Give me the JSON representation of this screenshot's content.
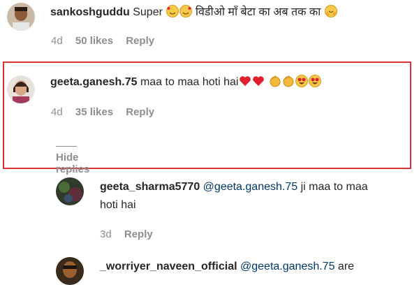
{
  "comments": [
    {
      "username": "sankoshguddu",
      "text_before": "Super",
      "text_after": "विडीओ माँ बेटा का अब तक का",
      "time": "4d",
      "likes": "50 likes",
      "reply_label": "Reply"
    },
    {
      "username": "geeta.ganesh.75",
      "text": "maa to maa hoti hai",
      "time": "4d",
      "likes": "35 likes",
      "reply_label": "Reply",
      "hide_replies_label": "Hide replies"
    }
  ],
  "replies": [
    {
      "username": "geeta_sharma5770",
      "mention": "@geeta.ganesh.75",
      "text_line1": "ji maa to maa",
      "text_line2": "hoti hai",
      "time": "3d",
      "reply_label": "Reply"
    },
    {
      "username": "_worriyer_naveen_official",
      "mention": "@geeta.ganesh.75",
      "text_line1": "are"
    }
  ],
  "colors": {
    "highlight_border": "#d9343a",
    "text": "#262626",
    "meta": "#8e8e8e",
    "mention": "#00376b"
  }
}
